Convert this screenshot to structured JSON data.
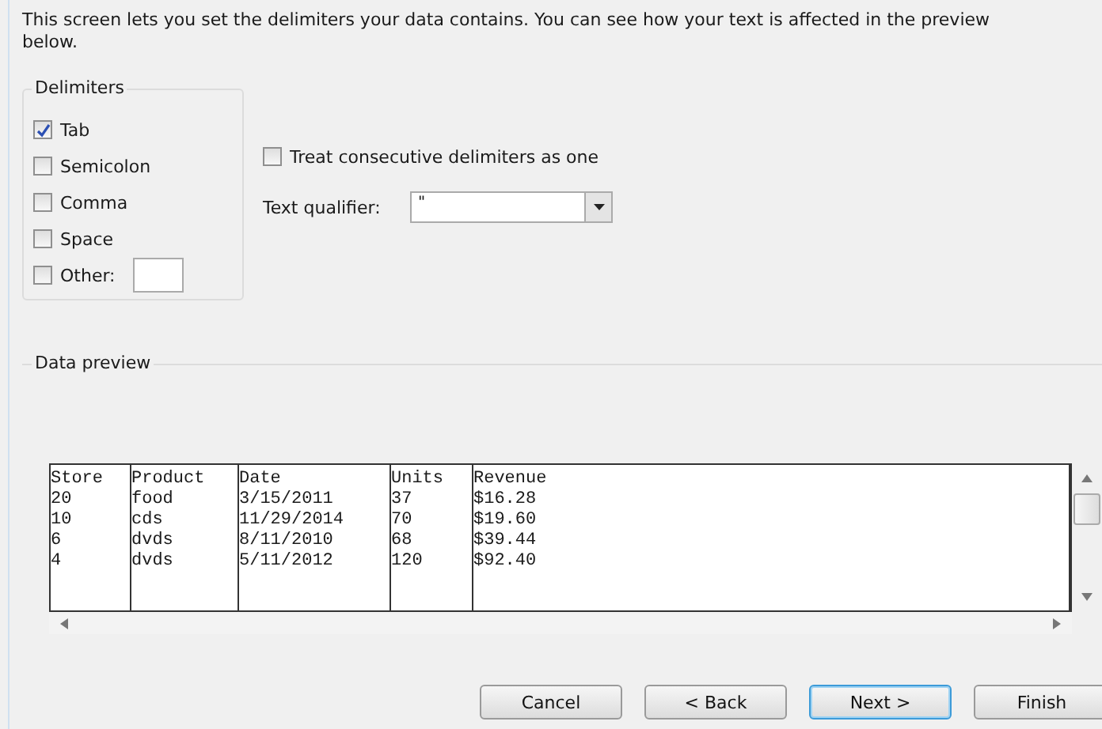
{
  "intro": "This screen lets you set the delimiters your data contains.  You can see how your text is affected in the preview below.",
  "delimiters": {
    "title": "Delimiters",
    "items": [
      {
        "label": "Tab",
        "checked": true,
        "kind": "plain"
      },
      {
        "label": "Semicolon",
        "checked": false,
        "kind": "plain"
      },
      {
        "label": "Comma",
        "checked": false,
        "kind": "plain"
      },
      {
        "label": "Space",
        "checked": false,
        "kind": "plain"
      },
      {
        "label": "Other:",
        "checked": false,
        "kind": "with-field"
      }
    ]
  },
  "consecutive": {
    "label": "Treat consecutive delimiters as one",
    "checked": false
  },
  "qualifier": {
    "label": "Text qualifier:",
    "value": "\""
  },
  "preview": {
    "title": "Data preview",
    "rows": [
      [
        "Store",
        "Product",
        "Date",
        "Units",
        "Revenue"
      ],
      [
        "20",
        "food",
        "3/15/2011",
        "37",
        "$16.28"
      ],
      [
        "10",
        "cds",
        "11/29/2014",
        "70",
        "$19.60"
      ],
      [
        "6",
        "dvds",
        "8/11/2010",
        "68",
        "$39.44"
      ],
      [
        "4",
        "dvds",
        "5/11/2012",
        "120",
        "$92.40"
      ]
    ]
  },
  "buttons": [
    {
      "label": "Cancel",
      "selected": false
    },
    {
      "label": "< Back",
      "selected": false
    },
    {
      "label": "Next >",
      "selected": true
    },
    {
      "label": "Finish",
      "selected": false
    }
  ]
}
